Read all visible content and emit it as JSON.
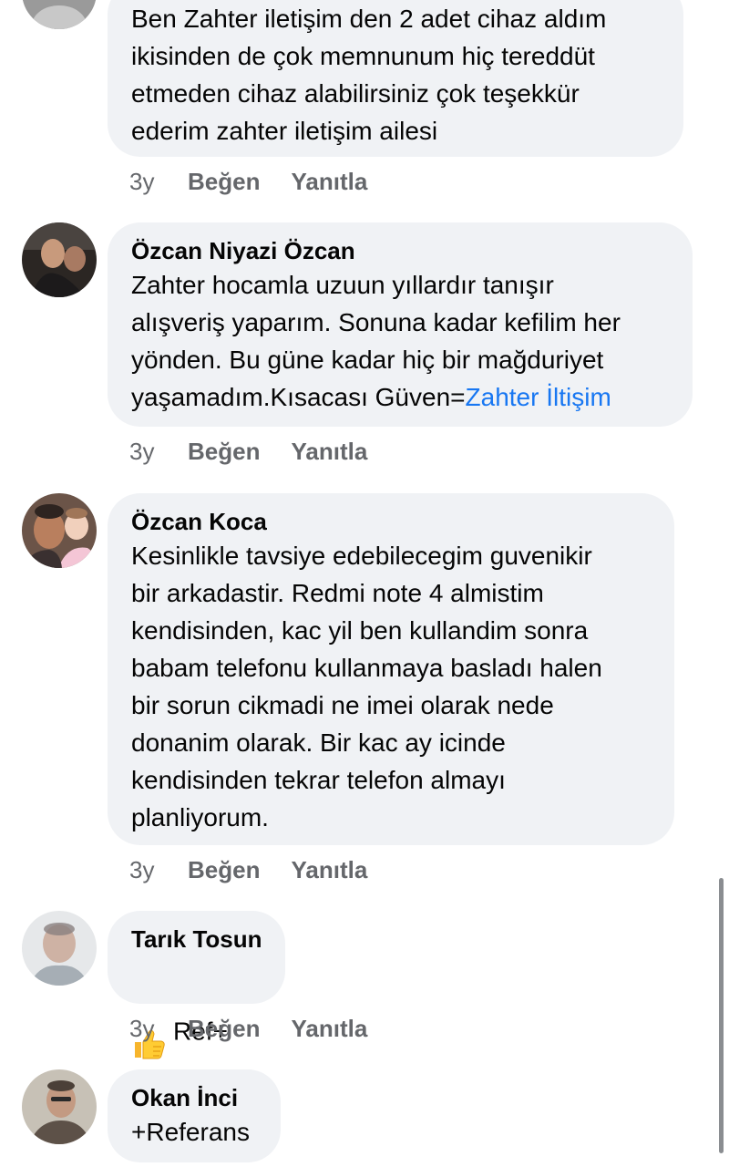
{
  "comments": [
    {
      "author": "",
      "text": "Ben Zahter iletişim den 2 adet cihaz aldım\nikisinden de çok memnunum hiç tereddüt\netmeden cihaz alabilirsiniz çok teşekkür\nederim zahter iletişim ailesi",
      "time": "3y",
      "like": "Beğen",
      "reply": "Yanıtla"
    },
    {
      "author": "Özcan Niyazi Özcan",
      "text": "Zahter hocamla uzuun yıllardır tanışır\nalışveriş yaparım. Sonuna kadar kefilim her\nyönden. Bu güne kadar hiç bir mağduriyet\nyaşamadım.Kısacası Güven=",
      "link": "Zahter İltişim",
      "time": "3y",
      "like": "Beğen",
      "reply": "Yanıtla"
    },
    {
      "author": "Özcan Koca",
      "text": "Kesinlikle tavsiye edebilecegim guvenikir\nbir arkadastir. Redmi note 4 almistim\nkendisinden, kac yil ben kullandim sonra\nbabam telefonu kullanmaya basladı halen\nbir sorun cikmadi ne imei olarak nede\ndonanim olarak. Bir kac ay icinde\nkendisinden tekrar telefon almayı\nplanliyorum.",
      "time": "3y",
      "like": "Beğen",
      "reply": "Yanıtla"
    },
    {
      "author": "Tarık Tosun",
      "emoji": "thumbs-up-icon",
      "text": "Ref+",
      "time": "3y",
      "like": "Beğen",
      "reply": "Yanıtla"
    },
    {
      "author": "Okan İnci",
      "text": "+Referans"
    }
  ],
  "colors": {
    "bubble": "#f0f2f5",
    "link": "#1877f2",
    "meta": "#65676b",
    "text": "#050505"
  }
}
